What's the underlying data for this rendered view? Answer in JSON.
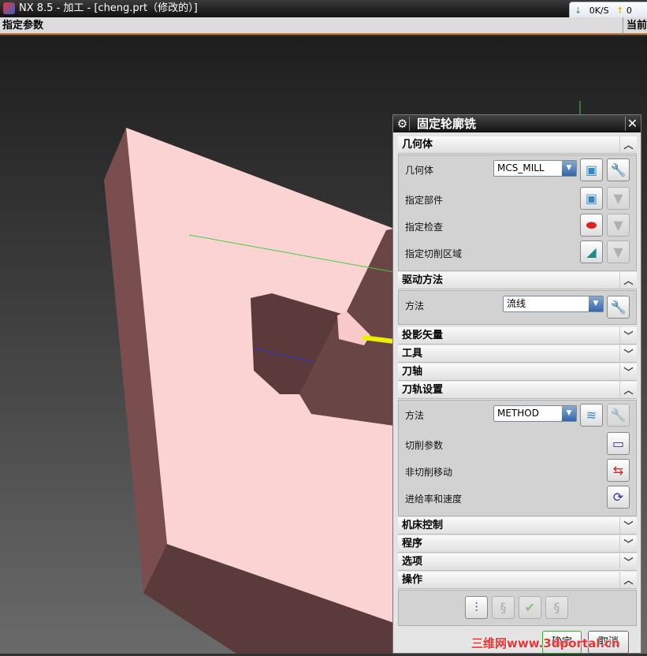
{
  "window": {
    "title": "NX 8.5 - 加工 - [cheng.prt（修改的）]"
  },
  "network": {
    "down": "0K/S",
    "up": "0"
  },
  "status": {
    "left": "指定参数",
    "right": "当前"
  },
  "dialog": {
    "title": "固定轮廓铣",
    "geometry": {
      "header": "几何体",
      "geometry_label": "几何体",
      "geometry_value": "MCS_MILL",
      "part_label": "指定部件",
      "check_label": "指定检查",
      "cut_area_label": "指定切削区域"
    },
    "drive": {
      "header": "驱动方法",
      "method_label": "方法",
      "method_value": "流线"
    },
    "collapsed": [
      "投影矢量",
      "工具",
      "刀轴"
    ],
    "path": {
      "header": "刀轨设置",
      "method_label": "方法",
      "method_value": "METHOD",
      "cut_params": "切削参数",
      "non_cut": "非切削移动",
      "feeds": "进给率和速度"
    },
    "collapsed2": [
      "机床控制",
      "程序",
      "选项"
    ],
    "ops": {
      "header": "操作"
    },
    "ok": "确定",
    "cancel": "取消"
  },
  "watermark": "三维网www.3dportal.cn"
}
